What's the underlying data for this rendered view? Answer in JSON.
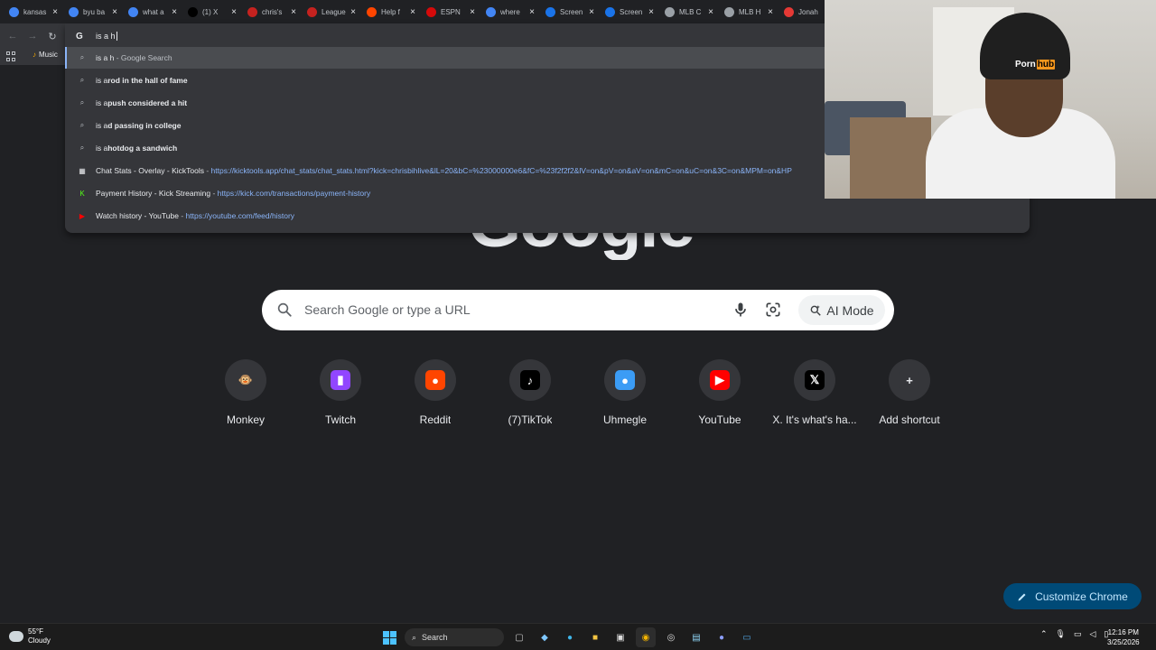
{
  "tabs": [
    {
      "title": "kansas",
      "favicon": "google",
      "color": "#4285f4"
    },
    {
      "title": "byu ba",
      "favicon": "google",
      "color": "#4285f4"
    },
    {
      "title": "what a",
      "favicon": "google",
      "color": "#4285f4"
    },
    {
      "title": "(1) X",
      "favicon": "x",
      "color": "#000000"
    },
    {
      "title": "chris's",
      "favicon": "red-square",
      "color": "#c5221f"
    },
    {
      "title": "League",
      "favicon": "red-square",
      "color": "#c5221f"
    },
    {
      "title": "Help f",
      "favicon": "reddit",
      "color": "#ff4500"
    },
    {
      "title": "ESPN",
      "favicon": "espn",
      "color": "#d50a0a"
    },
    {
      "title": "where",
      "favicon": "google",
      "color": "#4285f4"
    },
    {
      "title": "Screen",
      "favicon": "blue-c",
      "color": "#1a73e8"
    },
    {
      "title": "Screen",
      "favicon": "blue-c",
      "color": "#1a73e8"
    },
    {
      "title": "MLB C",
      "favicon": "globe",
      "color": "#9aa0a6"
    },
    {
      "title": "MLB H",
      "favicon": "globe",
      "color": "#9aa0a6"
    },
    {
      "title": "Jonah",
      "favicon": "red-dash",
      "color": "#e53935"
    }
  ],
  "omnibox": {
    "typed_text": "is a h",
    "suggestions": [
      {
        "prefix": "is a h",
        "bold": "",
        "suffix": " - Google Search",
        "icon": "search-icon",
        "url": "",
        "selected": true
      },
      {
        "prefix": "is a ",
        "bold": "rod in the hall of fame",
        "suffix": "",
        "icon": "search-icon",
        "url": "",
        "selected": false
      },
      {
        "prefix": "is a ",
        "bold": "push considered a hit",
        "suffix": "",
        "icon": "search-icon",
        "url": "",
        "selected": false
      },
      {
        "prefix": "is a ",
        "bold": "d passing in college",
        "suffix": "",
        "icon": "search-icon",
        "url": "",
        "selected": false
      },
      {
        "prefix": "is a ",
        "bold": "hotdog a sandwich",
        "suffix": "",
        "icon": "search-icon",
        "url": "",
        "selected": false
      },
      {
        "prefix": "Chat Stats - Overlay - KickTools",
        "bold": "",
        "suffix": " - ",
        "icon": "kicktools-icon",
        "url": "https://kicktools.app/chat_stats/chat_stats.html?kick=chrisbihlive&lL=20&bC=%23000000e6&fC=%23f2f2f2&lV=on&pV=on&aV=on&mC=on&uC=on&3C=on&MPM=on&HP",
        "selected": false
      },
      {
        "prefix": "Payment History - Kick Streaming",
        "bold": "",
        "suffix": " - ",
        "icon": "kick-icon",
        "url": "https://kick.com/transactions/payment-history",
        "selected": false
      },
      {
        "prefix": "Watch history - YouTube",
        "bold": "",
        "suffix": " - ",
        "icon": "youtube-icon",
        "url": "https://youtube.com/feed/history",
        "selected": false
      }
    ]
  },
  "bookmarks": {
    "item1": "Music"
  },
  "webcam": {
    "beanie_text_a": "Porn",
    "beanie_text_b": "hub"
  },
  "google_logo": "Google",
  "search": {
    "placeholder": "Search Google or type a URL",
    "ai_mode": "AI Mode"
  },
  "shortcuts": [
    {
      "label": "Monkey",
      "icon": "monkey-icon",
      "glyph": "🐵",
      "bg": "#35363a",
      "fg": "#d7a96b"
    },
    {
      "label": "Twitch",
      "icon": "twitch-icon",
      "glyph": "▮",
      "bg": "#9146ff",
      "fg": "#ffffff"
    },
    {
      "label": "Reddit",
      "icon": "reddit-icon",
      "glyph": "●",
      "bg": "#ff4500",
      "fg": "#ffffff"
    },
    {
      "label": "(7)TikTok",
      "icon": "tiktok-icon",
      "glyph": "♪",
      "bg": "#000000",
      "fg": "#ffffff"
    },
    {
      "label": "Uhmegle",
      "icon": "chat-bubble-icon",
      "glyph": "●",
      "bg": "#3b9cf5",
      "fg": "#ffffff"
    },
    {
      "label": "YouTube",
      "icon": "youtube-icon",
      "glyph": "▶",
      "bg": "#ff0000",
      "fg": "#ffffff"
    },
    {
      "label": "X. It's what's ha...",
      "icon": "x-icon",
      "glyph": "𝕏",
      "bg": "#000000",
      "fg": "#ffffff"
    },
    {
      "label": "Add shortcut",
      "icon": "plus-icon",
      "glyph": "+",
      "bg": "#35363a",
      "fg": "#e8eaed"
    }
  ],
  "customize_label": "Customize Chrome",
  "taskbar": {
    "temp": "55°F",
    "weather": "Cloudy",
    "search": "Search",
    "time": "12:16 PM",
    "date": "3/25/2026"
  }
}
